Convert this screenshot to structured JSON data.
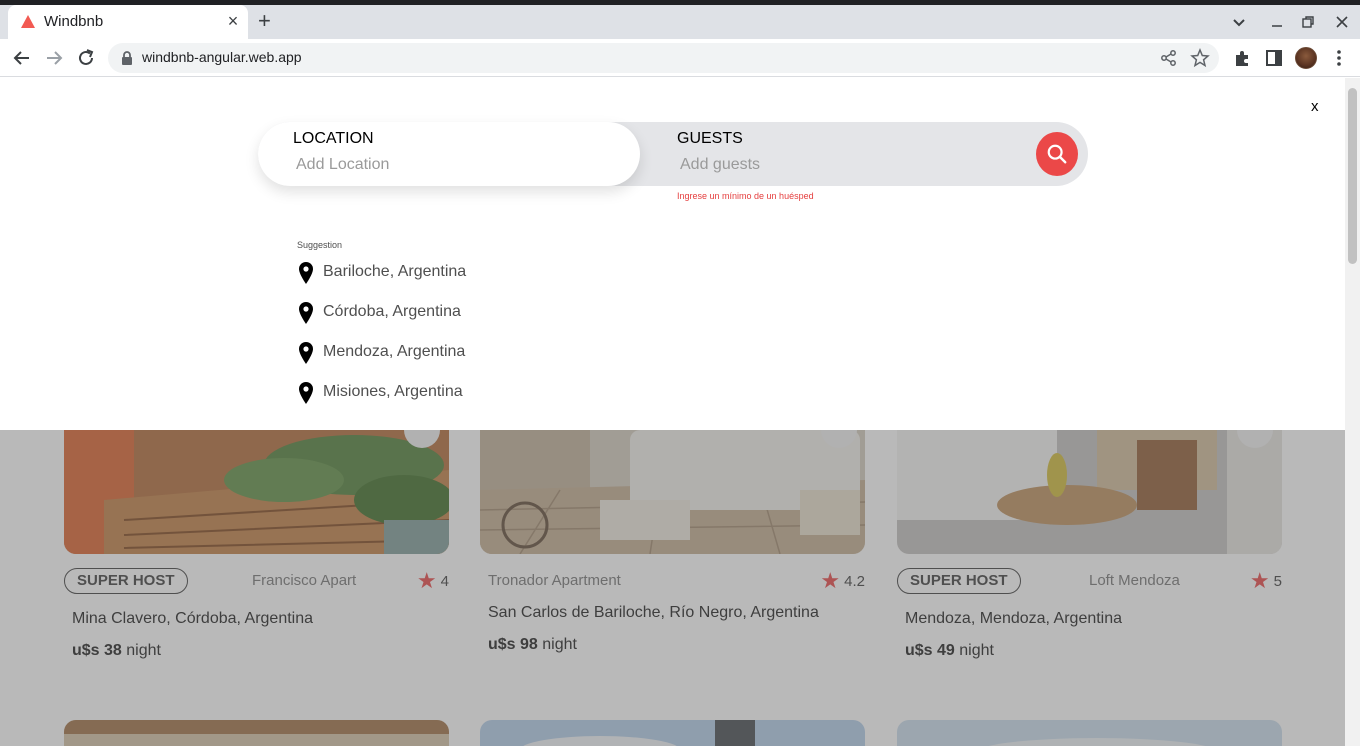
{
  "browser": {
    "tab_title": "Windbnb",
    "tab_close": "×",
    "new_tab": "+",
    "url": "windbnb-angular.web.app"
  },
  "search": {
    "location_label": "LOCATION",
    "location_placeholder": "Add Location",
    "guests_label": "GUESTS",
    "guests_placeholder": "Add guests",
    "error": "Ingrese un mínimo de un huésped",
    "close": "x"
  },
  "suggestions": {
    "title": "Suggestion",
    "items": [
      {
        "name": "Bariloche, Argentina"
      },
      {
        "name": "Córdoba, Argentina"
      },
      {
        "name": "Mendoza, Argentina"
      },
      {
        "name": "Misiones, Argentina"
      }
    ]
  },
  "listings": [
    {
      "superhost": "SUPER HOST",
      "type": "Francisco Apart",
      "rating": "4",
      "place": "Mina Clavero, Córdoba, Argentina",
      "price_currency_value": "u$s 38",
      "price_unit": " night"
    },
    {
      "superhost": "",
      "type": "Tronador Apartment",
      "rating": "4.2",
      "place": "San Carlos de Bariloche, Río Negro, Argentina",
      "price_currency_value": "u$s 98",
      "price_unit": " night"
    },
    {
      "superhost": "SUPER HOST",
      "type": "Loft Mendoza",
      "rating": "5",
      "place": "Mendoza, Mendoza, Argentina",
      "price_currency_value": "u$s 49",
      "price_unit": " night"
    }
  ],
  "colors": {
    "accent": "#eb5757",
    "search_button": "#eb4848",
    "error": "#e53e3e"
  },
  "icons": {
    "suggestion": "location-pin-icon",
    "rating": "star-icon",
    "search": "search-icon"
  }
}
